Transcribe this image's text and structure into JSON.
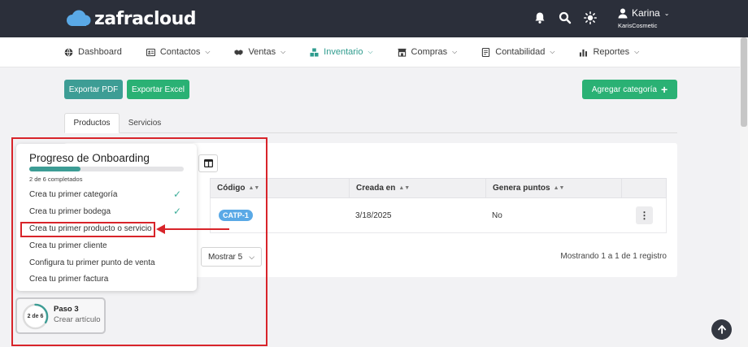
{
  "brand": {
    "name": "zafracloud",
    "color": "#5aa9e6"
  },
  "user": {
    "name": "Karina",
    "company": "KarisCosmetic"
  },
  "top_icons": [
    "bell-icon",
    "search-icon",
    "sun-icon"
  ],
  "nav": [
    {
      "id": "dashboard",
      "label": "Dashboard",
      "icon": "globe-icon",
      "has_menu": false,
      "active": false
    },
    {
      "id": "contactos",
      "label": "Contactos",
      "icon": "id-card-icon",
      "has_menu": true,
      "active": false
    },
    {
      "id": "ventas",
      "label": "Ventas",
      "icon": "handshake-icon",
      "has_menu": true,
      "active": false
    },
    {
      "id": "inventario",
      "label": "Inventario",
      "icon": "boxes-icon",
      "has_menu": true,
      "active": true
    },
    {
      "id": "compras",
      "label": "Compras",
      "icon": "store-icon",
      "has_menu": true,
      "active": false
    },
    {
      "id": "contabilidad",
      "label": "Contabilidad",
      "icon": "ledger-icon",
      "has_menu": true,
      "active": false
    },
    {
      "id": "reportes",
      "label": "Reportes",
      "icon": "bar-chart-icon",
      "has_menu": true,
      "active": false
    }
  ],
  "actions": {
    "export_pdf": "Exportar PDF",
    "export_excel": "Exportar Excel",
    "add_category": "Agregar categoría"
  },
  "tabs": [
    {
      "label": "Productos",
      "active": true
    },
    {
      "label": "Servicios",
      "active": false
    }
  ],
  "table": {
    "columns": [
      "Código",
      "Creada en",
      "Genera puntos"
    ],
    "rows": [
      {
        "codigo": "CATP-1",
        "creada_en": "3/18/2025",
        "genera_puntos": "No"
      }
    ]
  },
  "pagination": {
    "page_size_label": "Mostrar 5",
    "records_text": "Mostrando 1 a 1 de 1 registro"
  },
  "onboarding": {
    "title": "Progreso de Onboarding",
    "progress_text": "2 de 6 completados",
    "progress_fraction": 0.333,
    "tasks": [
      {
        "label": "Crea tu primer categoría",
        "done": true
      },
      {
        "label": "Crea tu primer bodega",
        "done": true
      },
      {
        "label": "Crea tu primer producto o servicio",
        "done": false
      },
      {
        "label": "Crea tu primer cliente",
        "done": false
      },
      {
        "label": "Configura tu primer punto de venta",
        "done": false
      },
      {
        "label": "Crea tu primer factura",
        "done": false
      }
    ]
  },
  "step": {
    "ring_label": "2 de 6",
    "title": "Paso 3",
    "subtitle": "Crear artículo",
    "fraction": 0.333
  },
  "colors": {
    "primary": "#3d9d95",
    "success": "#2ab174",
    "annotation": "#d8242a",
    "topbar": "#2b2f3a"
  }
}
